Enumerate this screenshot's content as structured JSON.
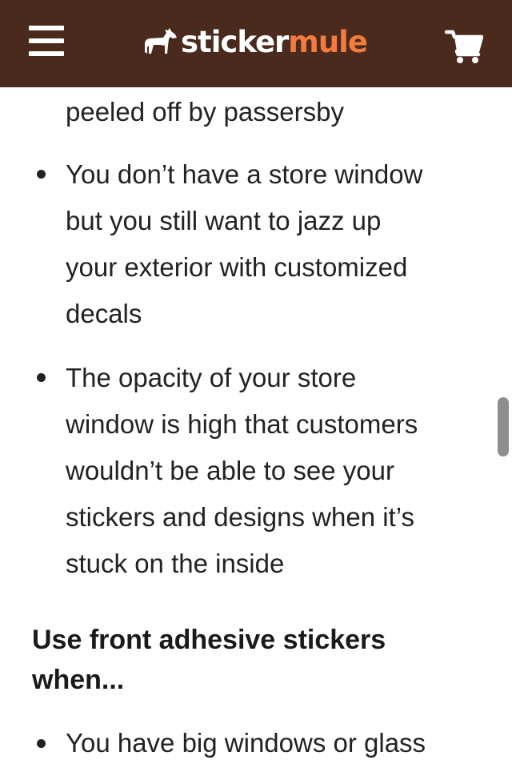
{
  "header": {
    "menu_icon": "hamburger-menu-icon",
    "logo": {
      "part1": "sticker",
      "part2": "mule",
      "icon": "mule-logo-icon"
    },
    "cart_icon": "shopping-cart-icon",
    "colors": {
      "background": "#4a2a1c",
      "accent": "#f47b3e",
      "text": "#ffffff"
    }
  },
  "article": {
    "continued_line": "peeled off by passersby",
    "list1": [
      {
        "lines": [
          "You don’t have a store window",
          "but you still want to jazz up",
          "your exterior with customized",
          "decals"
        ]
      },
      {
        "lines": [
          "The opacity of your store",
          "window is high that customers",
          "wouldn’t be able to see your",
          "stickers and designs when it’s",
          "stuck on the inside"
        ]
      }
    ],
    "heading": {
      "line1": "Use front adhesive stickers",
      "line2": "when..."
    },
    "list2": [
      {
        "lines": [
          "You have big windows or glass"
        ]
      }
    ]
  }
}
